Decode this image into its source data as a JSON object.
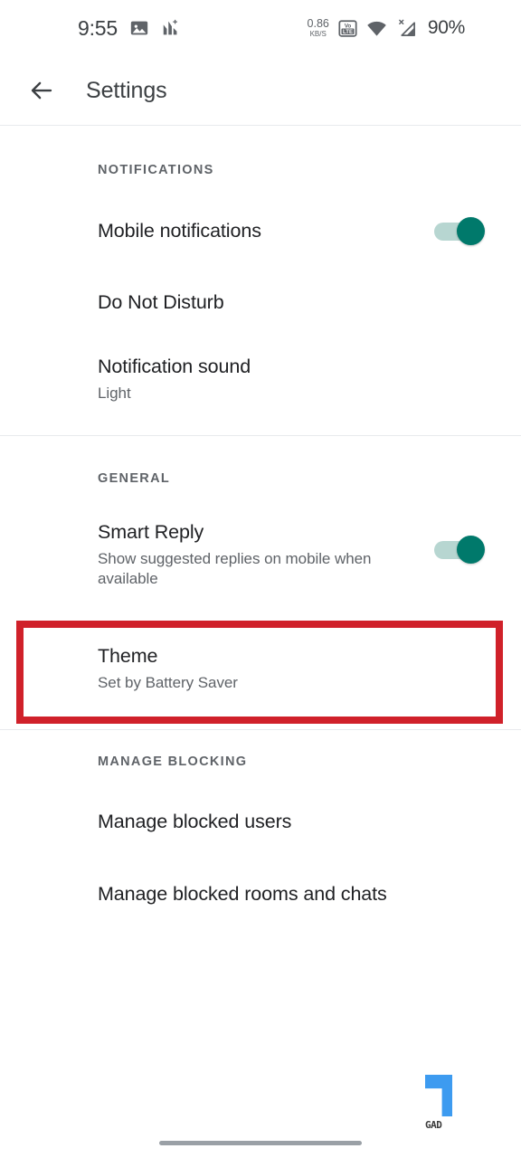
{
  "status_bar": {
    "clock": "9:55",
    "left_icons": [
      "image-icon",
      "signal-chart-icon"
    ],
    "net_speed_rate": "0.86",
    "net_speed_unit": "KB/S",
    "volte_label_top": "VoLTE",
    "volte_line1": "Vo",
    "volte_line2": "LTE",
    "right_icons": [
      "volte-icon",
      "wifi-icon",
      "cellular-signal-off-icon"
    ],
    "signal_x_mark": "X",
    "battery_percent": "90%"
  },
  "app_bar": {
    "back_icon": "arrow-back-icon",
    "title": "Settings"
  },
  "sections": [
    {
      "header": "NOTIFICATIONS",
      "rows": [
        {
          "title": "Mobile notifications",
          "subtitle": "",
          "toggle": "on"
        },
        {
          "title": "Do Not Disturb",
          "subtitle": "",
          "toggle": "none"
        },
        {
          "title": "Notification sound",
          "subtitle": "Light",
          "toggle": "none"
        }
      ]
    },
    {
      "header": "GENERAL",
      "rows": [
        {
          "title": "Smart Reply",
          "subtitle": "Show suggested replies on mobile when available",
          "toggle": "on"
        },
        {
          "title": "Theme",
          "subtitle": "Set by Battery Saver",
          "toggle": "none"
        }
      ]
    },
    {
      "header": "MANAGE BLOCKING",
      "rows": [
        {
          "title": "Manage blocked users",
          "subtitle": "",
          "toggle": "none"
        },
        {
          "title": "Manage blocked rooms and chats",
          "subtitle": "",
          "toggle": "none"
        }
      ]
    }
  ],
  "highlight": {
    "target": "Theme",
    "color": "#d0212a"
  },
  "watermark": {
    "text": "GAD"
  },
  "colors": {
    "toggle_on_thumb": "#00796b",
    "toggle_on_track": "#9fc8c2",
    "title_text": "#202124",
    "subtitle_text": "#5f6368",
    "divider": "#e8eaed",
    "highlight_red": "#d0212a",
    "watermark_blue": "#3d9bf0"
  }
}
